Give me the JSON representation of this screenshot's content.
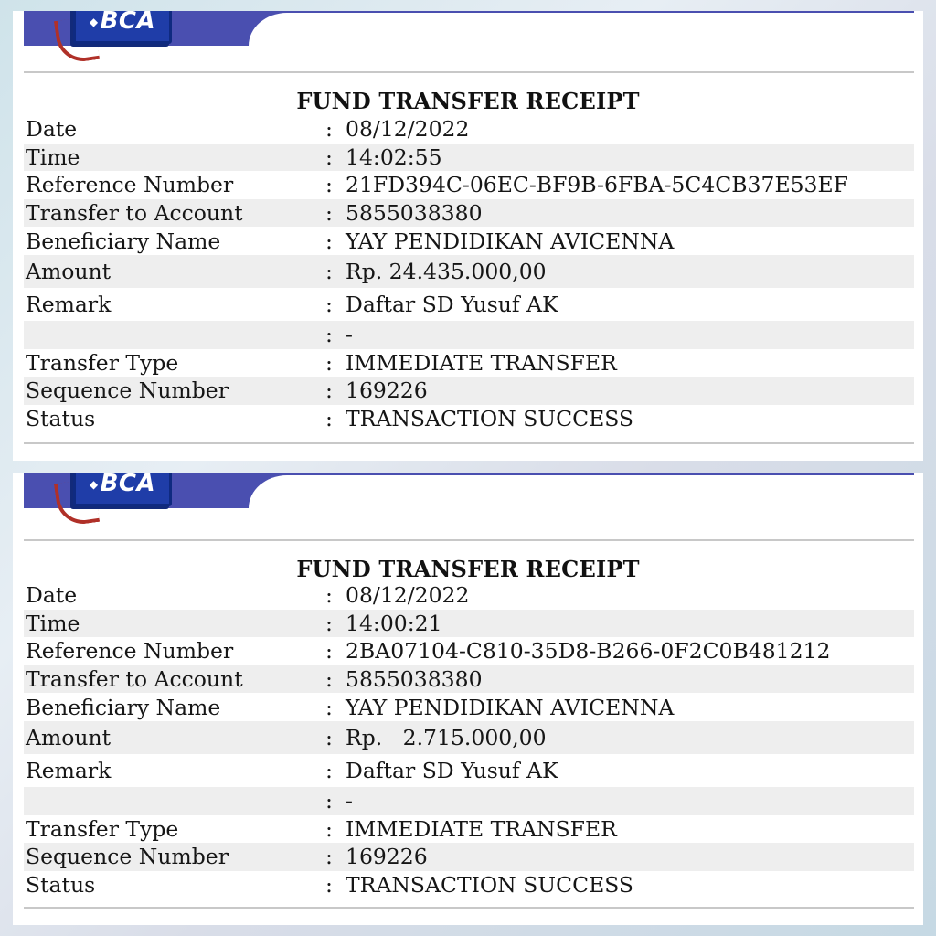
{
  "bank_logo_text": "BCA",
  "receipts": [
    {
      "title": "FUND TRANSFER RECEIPT",
      "rows": [
        {
          "label": "Date",
          "value": "08/12/2022"
        },
        {
          "label": "Time",
          "value": "14:02:55"
        },
        {
          "label": "Reference Number",
          "value": "21FD394C-06EC-BF9B-6FBA-5C4CB37E53EF"
        },
        {
          "label": "Transfer to Account",
          "value": "5855038380"
        },
        {
          "label": "Beneficiary Name",
          "value": "YAY PENDIDIKAN AVICENNA"
        },
        {
          "label": "Amount",
          "value": "Rp. 24.435.000,00"
        },
        {
          "label": "Remark",
          "value": "Daftar SD Yusuf AK"
        },
        {
          "label": "",
          "value": "-"
        },
        {
          "label": "Transfer Type",
          "value": "IMMEDIATE TRANSFER"
        },
        {
          "label": "Sequence Number",
          "value": "169226"
        },
        {
          "label": "Status",
          "value": "TRANSACTION SUCCESS"
        }
      ]
    },
    {
      "title": "FUND TRANSFER RECEIPT",
      "rows": [
        {
          "label": "Date",
          "value": "08/12/2022"
        },
        {
          "label": "Time",
          "value": "14:00:21"
        },
        {
          "label": "Reference Number",
          "value": "2BA07104-C810-35D8-B266-0F2C0B481212"
        },
        {
          "label": "Transfer to Account",
          "value": "5855038380"
        },
        {
          "label": "Beneficiary Name",
          "value": "YAY PENDIDIKAN AVICENNA"
        },
        {
          "label": "Amount",
          "value": "Rp.   2.715.000,00"
        },
        {
          "label": "Remark",
          "value": "Daftar SD Yusuf AK"
        },
        {
          "label": "",
          "value": "-"
        },
        {
          "label": "Transfer Type",
          "value": "IMMEDIATE TRANSFER"
        },
        {
          "label": "Sequence Number",
          "value": "169226"
        },
        {
          "label": "Status",
          "value": "TRANSACTION SUCCESS"
        }
      ]
    }
  ],
  "separator": ":",
  "colors": {
    "header_band": "#4a4fb0",
    "logo_blue": "#1f3da8",
    "row_stripe": "#eeeeee"
  }
}
